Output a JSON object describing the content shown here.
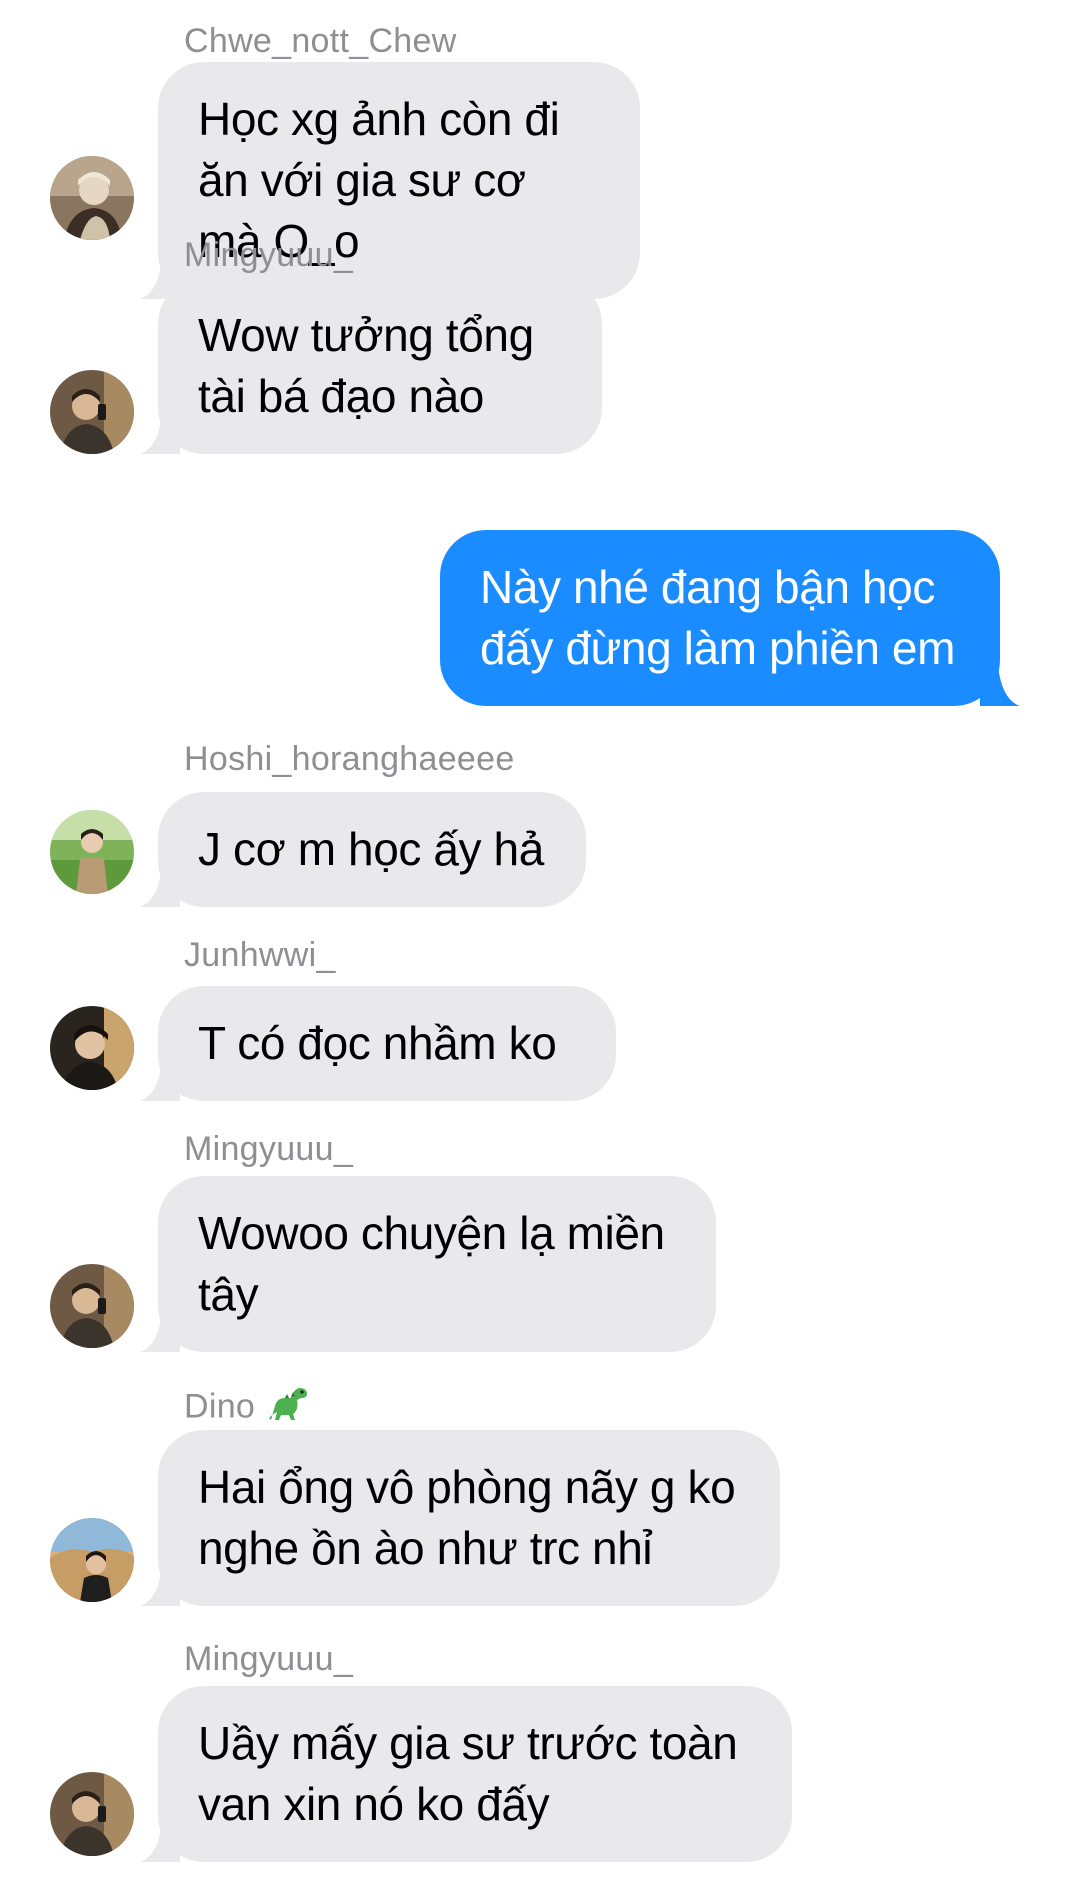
{
  "messages": [
    {
      "sender": "Chwe_nott_Chew",
      "avatar": "avatar-chwe",
      "text": "Học xg ảnh còn đi ăn với gia sư cơ mà O_o",
      "direction": "incoming"
    },
    {
      "sender": "Mingyuuu_",
      "avatar": "avatar-mingyu",
      "text": "Wow tưởng tổng tài bá đạo nào",
      "direction": "incoming"
    },
    {
      "sender": "",
      "avatar": "",
      "text": "Này nhé đang bận học đấy đừng làm phiền em",
      "direction": "outgoing"
    },
    {
      "sender": "Hoshi_horanghaeeee",
      "avatar": "avatar-hoshi",
      "text": "J cơ m học ấy hả",
      "direction": "incoming"
    },
    {
      "sender": "Junhwwi_",
      "avatar": "avatar-junhwi",
      "text": "T có đọc nhầm ko",
      "direction": "incoming"
    },
    {
      "sender": "Mingyuuu_",
      "avatar": "avatar-mingyu",
      "text": "Wowoo chuyện lạ miền tây",
      "direction": "incoming"
    },
    {
      "sender": "Dino",
      "sender_emoji": "dinosaur-emoji",
      "avatar": "avatar-dino",
      "text": "Hai ổng vô phòng nãy g ko nghe ồn ào như trc nhỉ",
      "direction": "incoming"
    },
    {
      "sender": "Mingyuuu_",
      "avatar": "avatar-mingyu",
      "text": "Uầy mấy gia sư trước toàn van xin nó ko đấy",
      "direction": "incoming"
    }
  ],
  "colors": {
    "incoming_bubble": "#e9e9eb",
    "outgoing_bubble": "#1a8cff",
    "sender_name": "#8e8e93",
    "background": "#ffffff"
  }
}
